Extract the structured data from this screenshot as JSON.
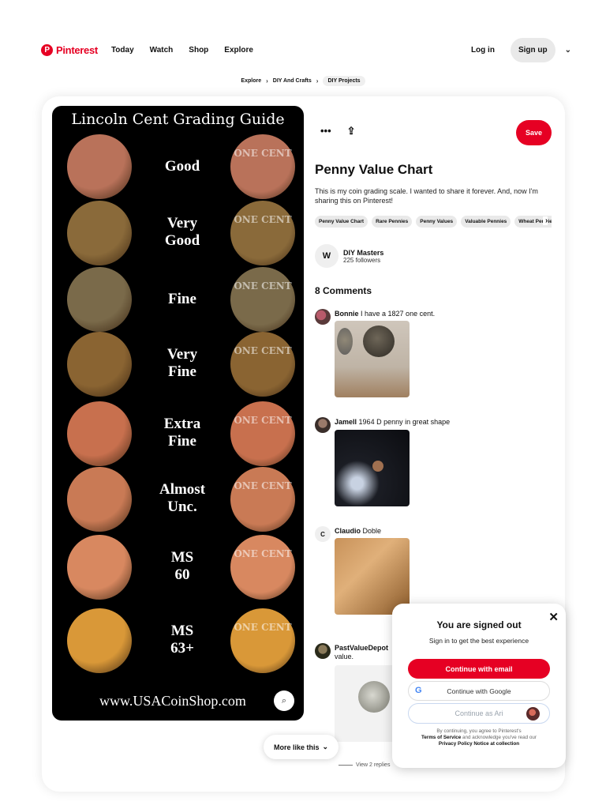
{
  "header": {
    "brand": "Pinterest",
    "brand_mark": "P",
    "nav": [
      "Today",
      "Watch",
      "Shop",
      "Explore"
    ],
    "login": "Log in",
    "signup": "Sign up",
    "chevron": "⌄"
  },
  "breadcrumb": {
    "items": [
      "Explore",
      "DIY And Crafts",
      "DIY Projects"
    ],
    "separator": "›"
  },
  "pin_image": {
    "title": "Lincoln Cent Grading Guide",
    "coin_reverse_text": "ONE CENT",
    "grades": [
      {
        "label_1": "Good",
        "label_2": ""
      },
      {
        "label_1": "Very",
        "label_2": "Good"
      },
      {
        "label_1": "Fine",
        "label_2": ""
      },
      {
        "label_1": "Very",
        "label_2": "Fine"
      },
      {
        "label_1": "Extra",
        "label_2": "Fine"
      },
      {
        "label_1": "Almost",
        "label_2": "Unc."
      },
      {
        "label_1": "MS",
        "label_2": "60"
      },
      {
        "label_1": "MS",
        "label_2": "63+"
      }
    ],
    "coin_colors": [
      "#b9725a",
      "#8a6a3a",
      "#7a6a4a",
      "#8a6432",
      "#c8704e",
      "#c97a55",
      "#d88860",
      "#d99838"
    ],
    "url": "www.USACoinShop.com"
  },
  "pin": {
    "actions": {
      "more": "•••",
      "share": "⇪"
    },
    "save": "Save",
    "title": "Penny Value Chart",
    "description": "This is my coin grading scale. I wanted to share it forever. And, now I'm sharing this on Pinterest!",
    "tags": [
      "Penny Value Chart",
      "Rare Pennies",
      "Penny Values",
      "Valuable Pennies",
      "Wheat Pennies"
    ],
    "tags_arrow": "›"
  },
  "creator": {
    "initial": "W",
    "name": "DIY Masters",
    "followers": "225 followers"
  },
  "comments": {
    "heading": "8 Comments",
    "items": [
      {
        "author": "Bonnie",
        "text": "I have a 1827 one cent.",
        "initial": ""
      },
      {
        "author": "Jamell",
        "text": "1964 D penny in great shape",
        "initial": ""
      },
      {
        "author": "Claudio",
        "text": "Doble",
        "initial": "C"
      },
      {
        "author": "PastValueDepot",
        "text": "value.",
        "initial": ""
      }
    ],
    "view_replies": "View 2 replies"
  },
  "more_like_this": "More like this",
  "more_like_this_chevron": "⌄",
  "modal": {
    "close": "✕",
    "title": "You are signed out",
    "subtitle": "Sign in to get the best experience",
    "continue_email": "Continue with email",
    "continue_google": "Continue with Google",
    "google_glyph": "G",
    "continue_as": "Continue as Ari",
    "legal_1": "By continuing, you agree to Pinterest's",
    "terms": "Terms of Service",
    "legal_2": "and acknowledge you've read our",
    "privacy": "Privacy Policy",
    "notice": "Notice at collection"
  },
  "colors": {
    "brand_red": "#e60023",
    "google_blue": "#1a73e8"
  }
}
